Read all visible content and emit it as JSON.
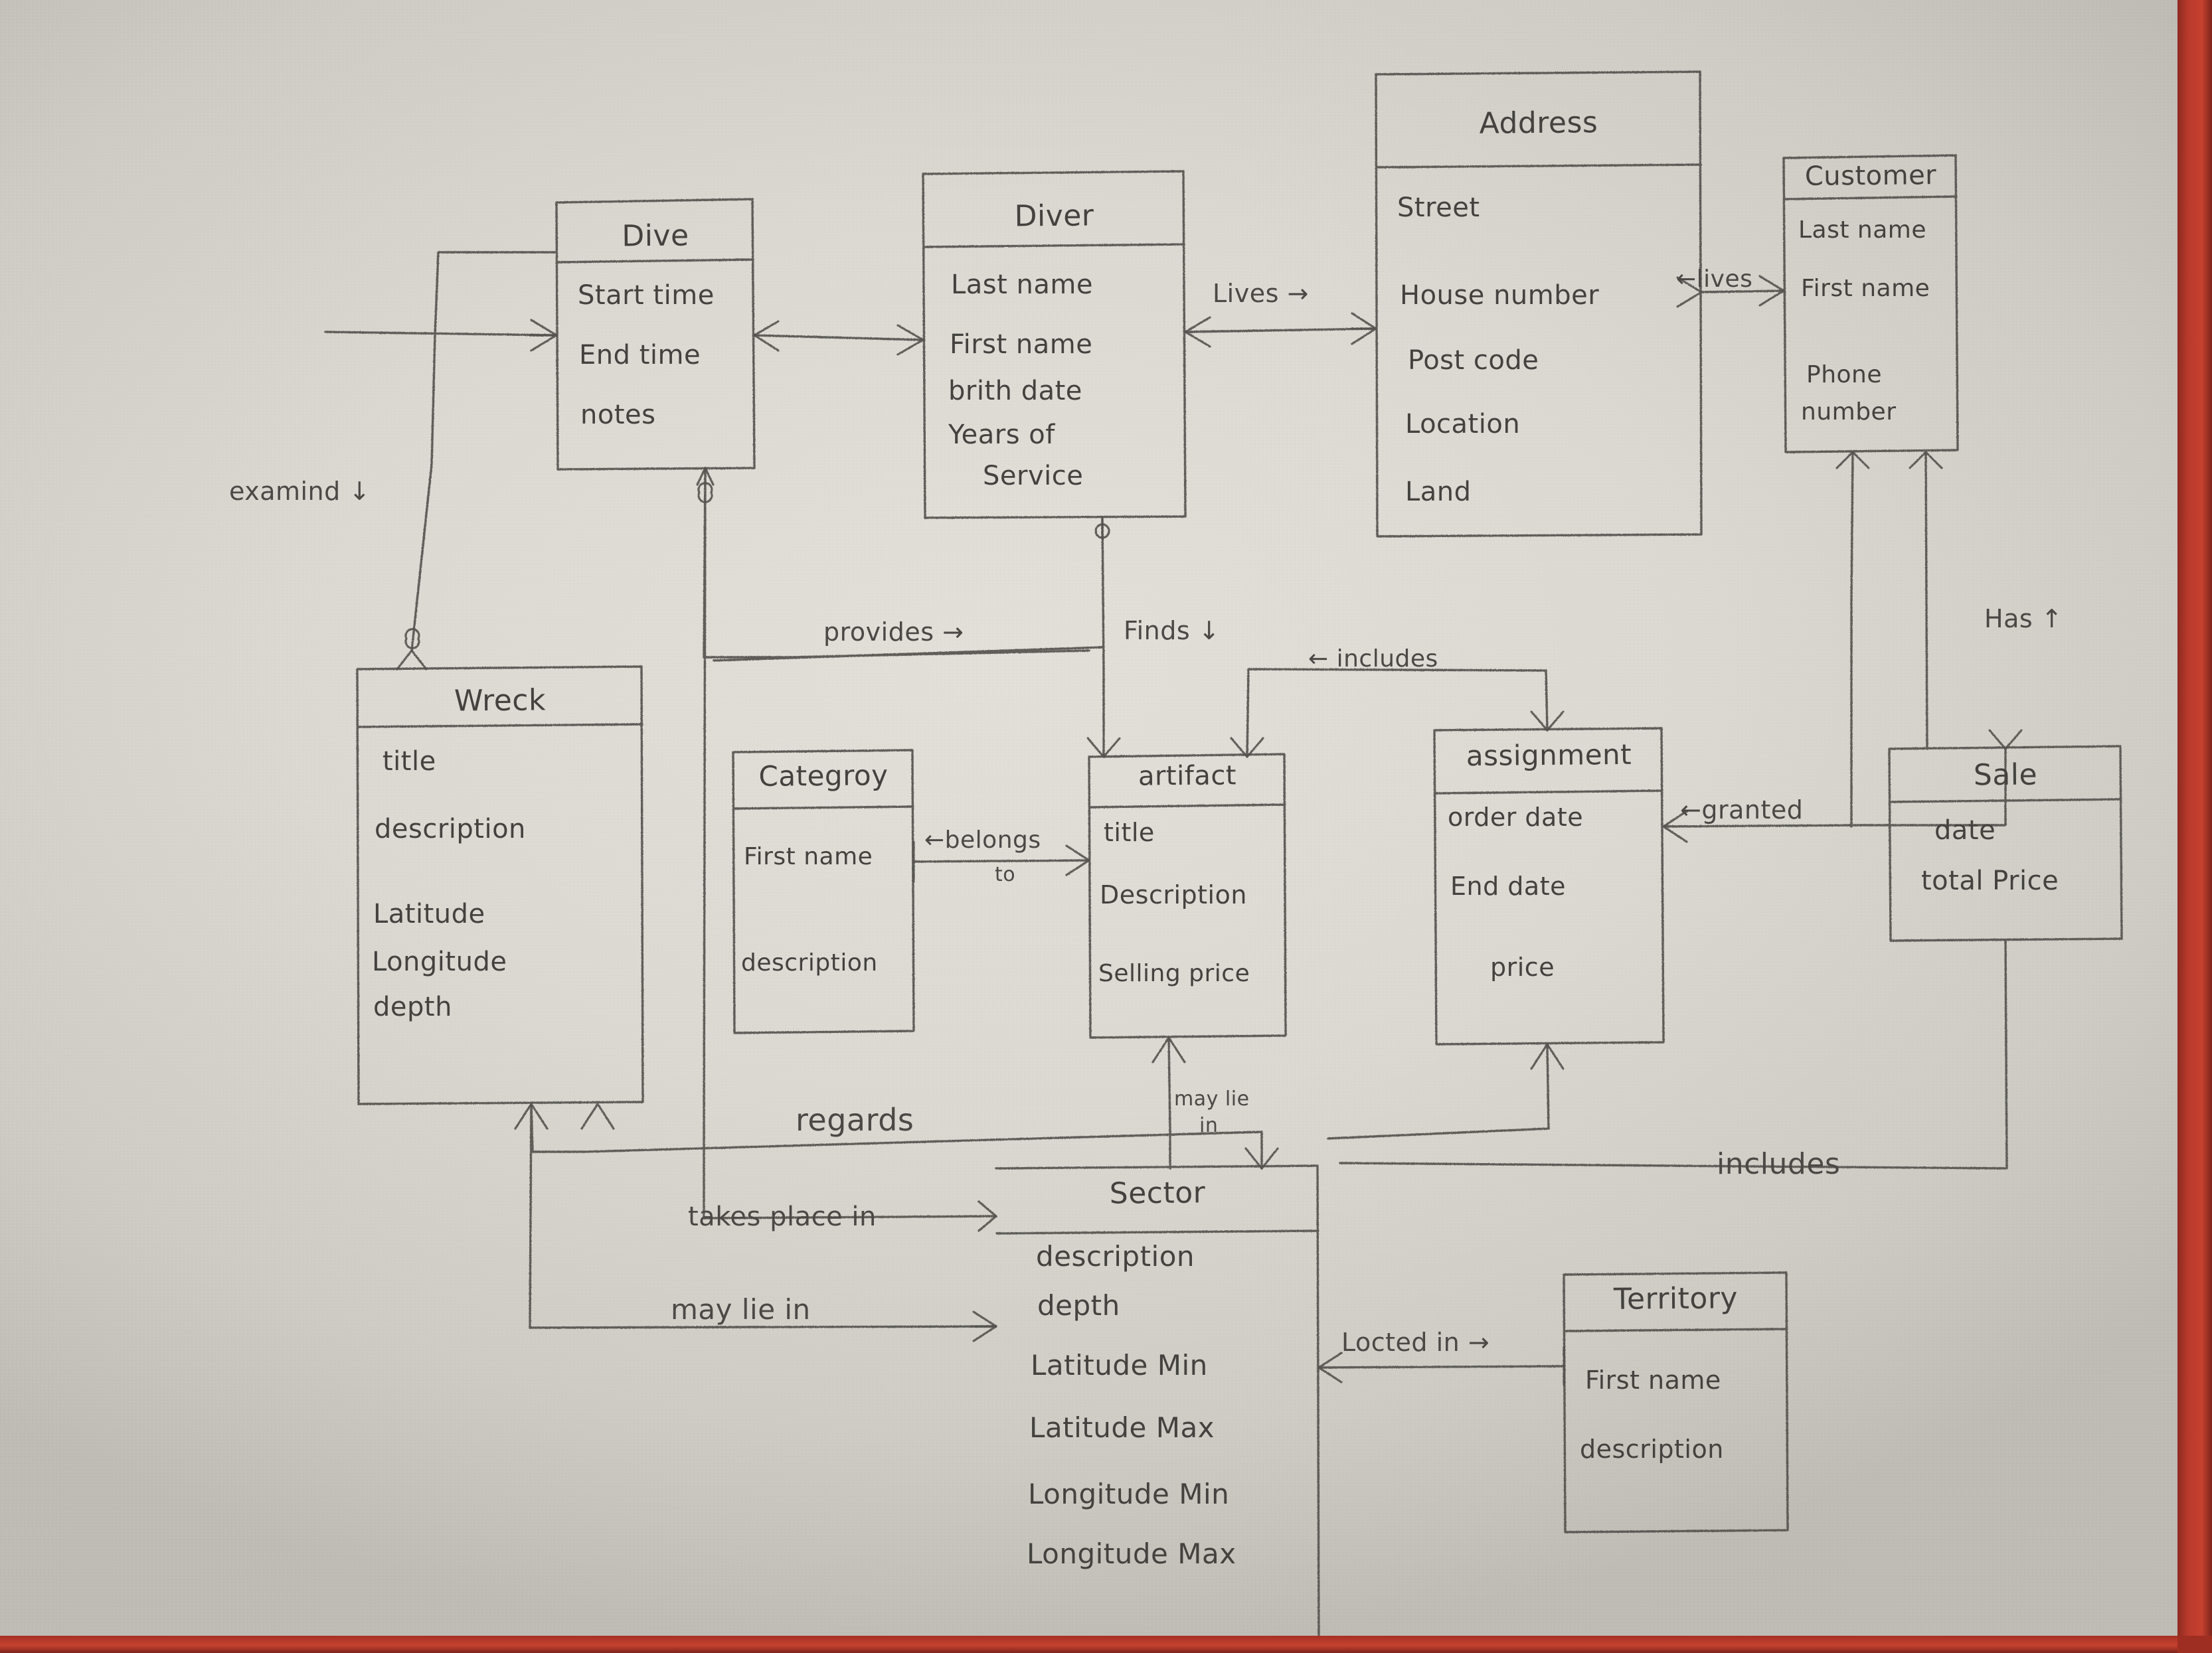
{
  "diagram": {
    "title": "Hand-drawn Entity Relationship Diagram",
    "medium": "pencil on paper",
    "ink_color": "#4a4845",
    "paper_color": "#dcd9d3",
    "desk_color": "#c6412f"
  },
  "entities": [
    {
      "key": "dive",
      "name": "Dive",
      "attributes": [
        "Start time",
        "End time",
        "notes"
      ]
    },
    {
      "key": "diver",
      "name": "Diver",
      "attributes": [
        "Last name",
        "First name",
        "brith date",
        "Years of",
        "Service"
      ]
    },
    {
      "key": "address",
      "name": "Address",
      "attributes": [
        "Street",
        "House number",
        "Post code",
        "Location",
        "Land"
      ]
    },
    {
      "key": "customer",
      "name": "Customer",
      "attributes": [
        "Last name",
        "First name",
        "Phone",
        "number"
      ]
    },
    {
      "key": "wreck",
      "name": "Wreck",
      "attributes": [
        "title",
        "description",
        "Latitude",
        "Longitude",
        "depth"
      ]
    },
    {
      "key": "category",
      "name": "Categroy",
      "attributes": [
        "First name",
        "description"
      ]
    },
    {
      "key": "artifact",
      "name": "artifact",
      "attributes": [
        "title",
        "Description",
        "Selling price"
      ]
    },
    {
      "key": "assignment",
      "name": "assignment",
      "attributes": [
        "order date",
        "End date",
        "price"
      ]
    },
    {
      "key": "sale",
      "name": "Sale",
      "attributes": [
        "date",
        "total Price"
      ]
    },
    {
      "key": "sector",
      "name": "Sector",
      "attributes": [
        "description",
        "depth",
        "Latitude Min",
        "Latitude Max",
        "Longitude Min",
        "Longitude Max"
      ]
    },
    {
      "key": "territory",
      "name": "Territory",
      "attributes": [
        "First name",
        "description"
      ]
    }
  ],
  "relationships": [
    {
      "key": "lives",
      "label": "Lives →",
      "from": "Diver",
      "to": "Address"
    },
    {
      "key": "lives2",
      "label": "←lives",
      "from": "Customer",
      "to": "Address"
    },
    {
      "key": "examind",
      "label": "examind ↓",
      "from": "Dive",
      "to": "Wreck"
    },
    {
      "key": "provides",
      "label": "provides →",
      "from": "Wreck",
      "to": "artifact"
    },
    {
      "key": "finds",
      "label": "Finds ↓",
      "from": "Diver",
      "to": "artifact"
    },
    {
      "key": "includes-top",
      "label": "← includes",
      "from": "assignment",
      "to": "artifact"
    },
    {
      "key": "belongs-to",
      "label": "←belongs",
      "label2": "to",
      "from": "artifact",
      "to": "Categroy"
    },
    {
      "key": "granted",
      "label": "←granted",
      "from": "Sale",
      "to": "assignment"
    },
    {
      "key": "has",
      "label": "Has ↑",
      "from": "Customer",
      "to": "Sale"
    },
    {
      "key": "regards",
      "label": "regards",
      "from": "Wreck",
      "to": "Sector"
    },
    {
      "key": "may-lie-in-art",
      "label": "may lie",
      "label2": "in",
      "from": "artifact",
      "to": "Sector"
    },
    {
      "key": "takes-place-in",
      "label": "takes place in",
      "from": "Dive",
      "to": "Sector"
    },
    {
      "key": "may-lie-in",
      "label": "may lie in",
      "from": "Wreck",
      "to": "Sector"
    },
    {
      "key": "includes-bot",
      "label": "includes",
      "from": "Sale",
      "to": "Sector"
    },
    {
      "key": "located-in",
      "label": "Locted in →",
      "from": "Sector",
      "to": "Territory"
    }
  ]
}
